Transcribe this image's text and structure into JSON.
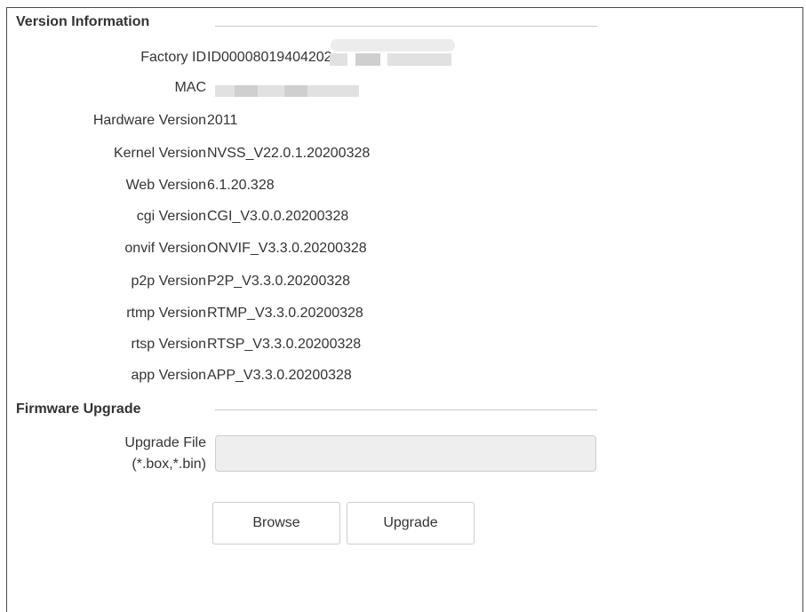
{
  "version_section": {
    "title": "Version Information",
    "rows": [
      {
        "label": "Factory ID",
        "value": "ID00008019404202"
      },
      {
        "label": "MAC",
        "value": ""
      },
      {
        "label": "Hardware Version",
        "value": "2011"
      },
      {
        "label": "Kernel Version",
        "value": "NVSS_V22.0.1.20200328"
      },
      {
        "label": "Web Version",
        "value": "6.1.20.328"
      },
      {
        "label": "cgi Version",
        "value": "CGI_V3.0.0.20200328"
      },
      {
        "label": "onvif Version",
        "value": "ONVIF_V3.3.0.20200328"
      },
      {
        "label": "p2p Version",
        "value": "P2P_V3.3.0.20200328"
      },
      {
        "label": "rtmp Version",
        "value": "RTMP_V3.3.0.20200328"
      },
      {
        "label": "rtsp Version",
        "value": "RTSP_V3.3.0.20200328"
      },
      {
        "label": "app Version",
        "value": "APP_V3.3.0.20200328"
      }
    ]
  },
  "firmware_section": {
    "title": "Firmware Upgrade",
    "upgrade_file_label_line1": "Upgrade File",
    "upgrade_file_label_line2": "(*.box,*.bin)",
    "file_value": "",
    "browse_label": "Browse",
    "upgrade_label": "Upgrade"
  }
}
